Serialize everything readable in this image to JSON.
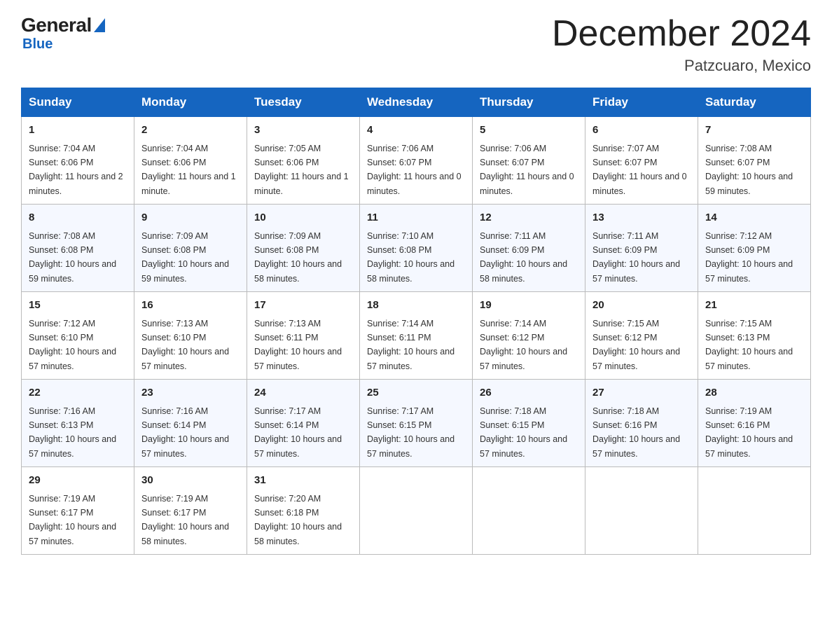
{
  "header": {
    "logo_text_general": "General",
    "logo_text_blue": "Blue",
    "month_title": "December 2024",
    "location": "Patzcuaro, Mexico"
  },
  "days_of_week": [
    "Sunday",
    "Monday",
    "Tuesday",
    "Wednesday",
    "Thursday",
    "Friday",
    "Saturday"
  ],
  "weeks": [
    [
      {
        "day": "1",
        "sunrise": "7:04 AM",
        "sunset": "6:06 PM",
        "daylight": "11 hours and 2 minutes."
      },
      {
        "day": "2",
        "sunrise": "7:04 AM",
        "sunset": "6:06 PM",
        "daylight": "11 hours and 1 minute."
      },
      {
        "day": "3",
        "sunrise": "7:05 AM",
        "sunset": "6:06 PM",
        "daylight": "11 hours and 1 minute."
      },
      {
        "day": "4",
        "sunrise": "7:06 AM",
        "sunset": "6:07 PM",
        "daylight": "11 hours and 0 minutes."
      },
      {
        "day": "5",
        "sunrise": "7:06 AM",
        "sunset": "6:07 PM",
        "daylight": "11 hours and 0 minutes."
      },
      {
        "day": "6",
        "sunrise": "7:07 AM",
        "sunset": "6:07 PM",
        "daylight": "11 hours and 0 minutes."
      },
      {
        "day": "7",
        "sunrise": "7:08 AM",
        "sunset": "6:07 PM",
        "daylight": "10 hours and 59 minutes."
      }
    ],
    [
      {
        "day": "8",
        "sunrise": "7:08 AM",
        "sunset": "6:08 PM",
        "daylight": "10 hours and 59 minutes."
      },
      {
        "day": "9",
        "sunrise": "7:09 AM",
        "sunset": "6:08 PM",
        "daylight": "10 hours and 59 minutes."
      },
      {
        "day": "10",
        "sunrise": "7:09 AM",
        "sunset": "6:08 PM",
        "daylight": "10 hours and 58 minutes."
      },
      {
        "day": "11",
        "sunrise": "7:10 AM",
        "sunset": "6:08 PM",
        "daylight": "10 hours and 58 minutes."
      },
      {
        "day": "12",
        "sunrise": "7:11 AM",
        "sunset": "6:09 PM",
        "daylight": "10 hours and 58 minutes."
      },
      {
        "day": "13",
        "sunrise": "7:11 AM",
        "sunset": "6:09 PM",
        "daylight": "10 hours and 57 minutes."
      },
      {
        "day": "14",
        "sunrise": "7:12 AM",
        "sunset": "6:09 PM",
        "daylight": "10 hours and 57 minutes."
      }
    ],
    [
      {
        "day": "15",
        "sunrise": "7:12 AM",
        "sunset": "6:10 PM",
        "daylight": "10 hours and 57 minutes."
      },
      {
        "day": "16",
        "sunrise": "7:13 AM",
        "sunset": "6:10 PM",
        "daylight": "10 hours and 57 minutes."
      },
      {
        "day": "17",
        "sunrise": "7:13 AM",
        "sunset": "6:11 PM",
        "daylight": "10 hours and 57 minutes."
      },
      {
        "day": "18",
        "sunrise": "7:14 AM",
        "sunset": "6:11 PM",
        "daylight": "10 hours and 57 minutes."
      },
      {
        "day": "19",
        "sunrise": "7:14 AM",
        "sunset": "6:12 PM",
        "daylight": "10 hours and 57 minutes."
      },
      {
        "day": "20",
        "sunrise": "7:15 AM",
        "sunset": "6:12 PM",
        "daylight": "10 hours and 57 minutes."
      },
      {
        "day": "21",
        "sunrise": "7:15 AM",
        "sunset": "6:13 PM",
        "daylight": "10 hours and 57 minutes."
      }
    ],
    [
      {
        "day": "22",
        "sunrise": "7:16 AM",
        "sunset": "6:13 PM",
        "daylight": "10 hours and 57 minutes."
      },
      {
        "day": "23",
        "sunrise": "7:16 AM",
        "sunset": "6:14 PM",
        "daylight": "10 hours and 57 minutes."
      },
      {
        "day": "24",
        "sunrise": "7:17 AM",
        "sunset": "6:14 PM",
        "daylight": "10 hours and 57 minutes."
      },
      {
        "day": "25",
        "sunrise": "7:17 AM",
        "sunset": "6:15 PM",
        "daylight": "10 hours and 57 minutes."
      },
      {
        "day": "26",
        "sunrise": "7:18 AM",
        "sunset": "6:15 PM",
        "daylight": "10 hours and 57 minutes."
      },
      {
        "day": "27",
        "sunrise": "7:18 AM",
        "sunset": "6:16 PM",
        "daylight": "10 hours and 57 minutes."
      },
      {
        "day": "28",
        "sunrise": "7:19 AM",
        "sunset": "6:16 PM",
        "daylight": "10 hours and 57 minutes."
      }
    ],
    [
      {
        "day": "29",
        "sunrise": "7:19 AM",
        "sunset": "6:17 PM",
        "daylight": "10 hours and 57 minutes."
      },
      {
        "day": "30",
        "sunrise": "7:19 AM",
        "sunset": "6:17 PM",
        "daylight": "10 hours and 58 minutes."
      },
      {
        "day": "31",
        "sunrise": "7:20 AM",
        "sunset": "6:18 PM",
        "daylight": "10 hours and 58 minutes."
      },
      null,
      null,
      null,
      null
    ]
  ]
}
